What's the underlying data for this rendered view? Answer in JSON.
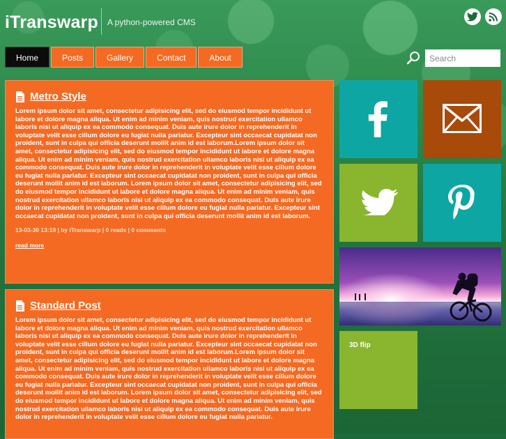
{
  "site": {
    "title": "iTranswarp",
    "tagline": "A python-powered CMS"
  },
  "header_social": [
    {
      "icon": "twitter-icon"
    },
    {
      "icon": "rss-icon"
    }
  ],
  "nav": {
    "items": [
      {
        "label": "Home",
        "active": true
      },
      {
        "label": "Posts",
        "active": false
      },
      {
        "label": "Gallery",
        "active": false
      },
      {
        "label": "Contact",
        "active": false
      },
      {
        "label": "About",
        "active": false
      }
    ]
  },
  "search": {
    "placeholder": "Search"
  },
  "posts": [
    {
      "title": "Metro Style",
      "body": "Lorem ipsum dolor sit amet, consectetur adipisicing elit, sed do eiusmod tempor incididunt ut labore et dolore magna aliqua. Ut enim ad minim veniam, quis nostrud exercitation ullamco laboris nisi ut aliquip ex ea commodo consequat. Duis aute irure dolor in reprehenderit in voluptate velit esse cillum dolore eu fugiat nulla pariatur. Excepteur sint occaecat cupidatat non proident, sunt in culpa qui officia deserunt mollit anim id est laborum.Lorem ipsum dolor sit amet, consectetur adipisicing elit, sed do eiusmod tempor incididunt ut labore et dolore magna aliqua. Ut enim ad minim veniam, quis nostrud exercitation ullamco laboris nisi ut aliquip ex ea commodo consequat. Duis aute irure dolor in reprehenderit in voluptate velit esse cillum dolore eu fugiat nulla pariatur. Excepteur sint occaecat cupidatat non proident, sunt in culpa qui officia deserunt mollit anim id est laborum. Lorem ipsum dolor sit amet, consectetur adipisicing elit, sed do eiusmod tempor incididunt ut labore et dolore magna aliqua. Ut enim ad minim veniam, quis nostrud exercitation ullamco laboris nisi ut aliquip ex ea commodo consequat. Duis aute irure dolor in reprehenderit in voluptate velit esse cillum dolore eu fugiat nulla pariatur. Excepteur sint occaecat cupidatat non proident, sunt in culpa qui officia deserunt mollit anim id est laborum.",
      "meta": "13-03-30 13:18 | by iTranswarp | 0 reads | 0 comments",
      "more": "read more"
    },
    {
      "title": "Standard Post",
      "body": "Lorem ipsum dolor sit amet, consectetur adipisicing elit, sed do eiusmod tempor incididunt ut labore et dolore magna aliqua. Ut enim ad minim veniam, quis nostrud exercitation ullamco laboris nisi ut aliquip ex ea commodo consequat. Duis aute irure dolor in reprehenderit in voluptate velit esse cillum dolore eu fugiat nulla pariatur. Excepteur sint occaecat cupidatat non proident, sunt in culpa qui officia deserunt mollit anim id est laborum.Lorem ipsum dolor sit amet, consectetur adipisicing elit, sed do eiusmod tempor incididunt ut labore et dolore magna aliqua. Ut enim ad minim veniam, quis nostrud exercitation ullamco laboris nisi ut aliquip ex ea commodo consequat. Duis aute irure dolor in reprehenderit in voluptate velit esse cillum dolore eu fugiat nulla pariatur. Excepteur sint occaecat cupidatat non proident, sunt in culpa qui officia deserunt mollit anim id est laborum. Lorem ipsum dolor sit amet, consectetur adipisicing elit, sed do eiusmod tempor incididunt ut labore et dolore magna aliqua. Ut enim ad minim veniam, quis nostrud exercitation ullamco laboris nisi ut aliquip ex ea commodo consequat. Duis aute irure dolor in reprehenderit in voluptate velit esse cillum dolore eu fugiat nulla pariatur."
    }
  ],
  "tiles": {
    "facebook": {
      "icon": "facebook-icon",
      "color": "#0ea6a3"
    },
    "mail": {
      "icon": "mail-icon",
      "color": "#a84a09"
    },
    "twitter": {
      "icon": "twitter-icon",
      "color": "#8ab52f"
    },
    "pinterest": {
      "icon": "pinterest-icon",
      "color": "#0ea6a3"
    },
    "photo": {
      "icon": "cyclist-sunset-image"
    },
    "flip": {
      "label": "3D flip",
      "color": "#8ab52f"
    }
  },
  "colors": {
    "accent": "#f46a22",
    "nav_active": "#0b0b0b",
    "background": "#1e6a3a"
  }
}
